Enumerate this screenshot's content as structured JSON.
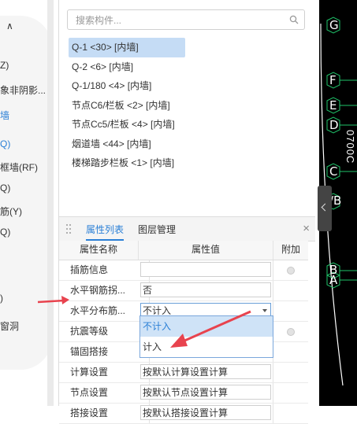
{
  "left_sidebar": {
    "items": [
      {
        "text": "∧"
      },
      {
        "text": "Z)"
      },
      {
        "text": "象非阴影..."
      },
      {
        "text": "墙"
      },
      {
        "text": "Q)"
      },
      {
        "text": "框墙(RF)"
      },
      {
        "text": "Q)"
      },
      {
        "text": "筋(Y)"
      },
      {
        "text": "Q)"
      },
      {
        "text": ")"
      },
      {
        "text": "窗洞"
      }
    ]
  },
  "search": {
    "placeholder": "搜索构件..."
  },
  "components": [
    "Q-1 <30> [内墙]",
    "Q-2 <6> [内墙]",
    "Q-1/180 <4> [内墙]",
    "节点C6/栏板 <2> [内墙]",
    "节点Cc5/栏板 <4> [内墙]",
    "烟道墙 <44> [内墙]",
    "楼梯踏步栏板 <1> [内墙]"
  ],
  "property_panel": {
    "tabs": [
      "属性列表",
      "图层管理"
    ],
    "close": "×",
    "columns": [
      "属性名称",
      "属性值",
      "附加"
    ],
    "rows": [
      {
        "name": "插筋信息",
        "value": ""
      },
      {
        "name": "水平钢筋拐...",
        "value": "否"
      },
      {
        "name": "水平分布筋...",
        "value": "不计入"
      },
      {
        "name": "抗震等级",
        "value": ""
      },
      {
        "name": "锚固搭接",
        "value": ""
      },
      {
        "name": "计算设置",
        "value": "按默认计算设置计算"
      },
      {
        "name": "节点设置",
        "value": "按默认节点设置计算"
      },
      {
        "name": "搭接设置",
        "value": "按默认搭接设置计算"
      }
    ]
  },
  "dropdown": {
    "options": [
      "不计入",
      "计入"
    ],
    "selected": "不计入"
  },
  "canvas": {
    "axis_labels": [
      "G",
      "F",
      "E",
      "D",
      "C",
      "/B",
      "B",
      "A"
    ],
    "vertical_text": "0700C"
  },
  "colors": {
    "accent": "#2a7fd6",
    "arrow": "#e8434e",
    "selection": "#c5dcf5",
    "axis_green": "#1fc46a"
  }
}
